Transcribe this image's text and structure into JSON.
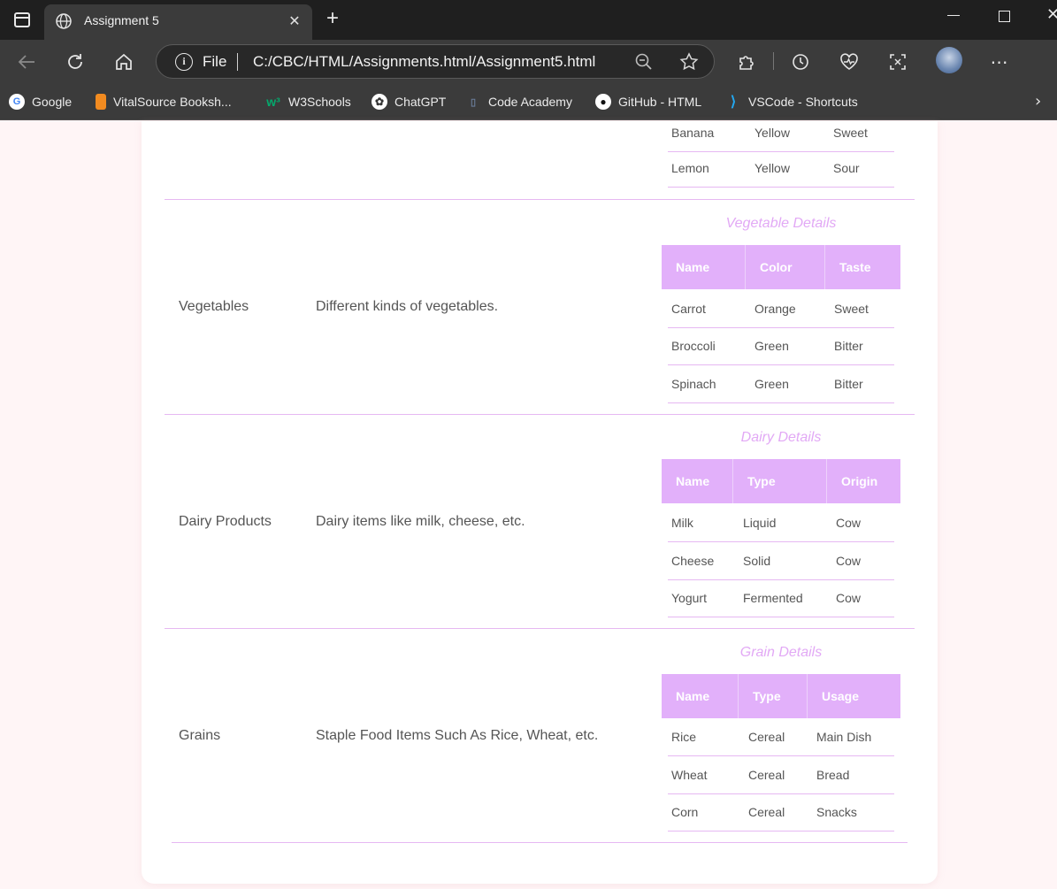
{
  "browser": {
    "tab_title": "Assignment 5",
    "address_scheme": "File",
    "address_url": "C:/CBC/HTML/Assignments.html/Assignment5.html",
    "bookmarks": [
      {
        "label": "Google",
        "icon": "google-icon"
      },
      {
        "label": "VitalSource Booksh...",
        "icon": "vitalsource-icon"
      },
      {
        "label": "W3Schools",
        "icon": "w3schools-icon"
      },
      {
        "label": "ChatGPT",
        "icon": "chatgpt-icon"
      },
      {
        "label": "Code Academy",
        "icon": "codeacademy-icon"
      },
      {
        "label": "GitHub - HTML",
        "icon": "github-icon"
      },
      {
        "label": "VSCode - Shortcuts",
        "icon": "vscode-icon"
      }
    ]
  },
  "fruits_partial": {
    "rows": [
      [
        "Banana",
        "Yellow",
        "Sweet"
      ],
      [
        "Lemon",
        "Yellow",
        "Sour"
      ]
    ]
  },
  "categories": [
    {
      "name": "Vegetables",
      "description": "Different kinds of vegetables.",
      "caption": "Vegetable Details",
      "headers": [
        "Name",
        "Color",
        "Taste"
      ],
      "rows": [
        [
          "Carrot",
          "Orange",
          "Sweet"
        ],
        [
          "Broccoli",
          "Green",
          "Bitter"
        ],
        [
          "Spinach",
          "Green",
          "Bitter"
        ]
      ]
    },
    {
      "name": "Dairy Products",
      "description": "Dairy items like milk, cheese, etc.",
      "caption": "Dairy Details",
      "headers": [
        "Name",
        "Type",
        "Origin"
      ],
      "rows": [
        [
          "Milk",
          "Liquid",
          "Cow"
        ],
        [
          "Cheese",
          "Solid",
          "Cow"
        ],
        [
          "Yogurt",
          "Fermented",
          "Cow"
        ]
      ]
    },
    {
      "name": "Grains",
      "description": "Staple Food Items Such As Rice, Wheat, etc.",
      "caption": "Grain Details",
      "headers": [
        "Name",
        "Type",
        "Usage"
      ],
      "rows": [
        [
          "Rice",
          "Cereal",
          "Main Dish"
        ],
        [
          "Wheat",
          "Cereal",
          "Bread"
        ],
        [
          "Corn",
          "Cereal",
          "Snacks"
        ]
      ]
    }
  ],
  "colors": {
    "accent_header": "#e2b0fa",
    "caption": "#e2a9f5",
    "row_border": "#e6b8f2",
    "page_bg": "#fff5f6"
  }
}
